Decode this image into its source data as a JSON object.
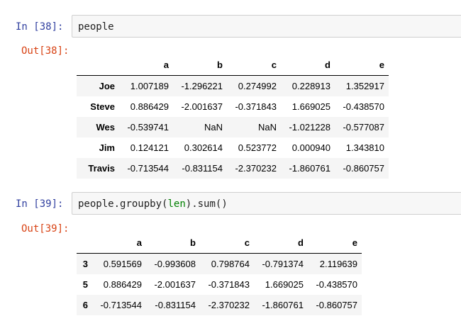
{
  "cells": [
    {
      "in_prompt": "In  [38]:",
      "code": "people",
      "out_prompt": "Out[38]:",
      "table": {
        "columns": [
          "a",
          "b",
          "c",
          "d",
          "e"
        ],
        "rows": [
          {
            "index": "Joe",
            "values": [
              "1.007189",
              "-1.296221",
              "0.274992",
              "0.228913",
              "1.352917"
            ]
          },
          {
            "index": "Steve",
            "values": [
              "0.886429",
              "-2.001637",
              "-0.371843",
              "1.669025",
              "-0.438570"
            ]
          },
          {
            "index": "Wes",
            "values": [
              "-0.539741",
              "NaN",
              "NaN",
              "-1.021228",
              "-0.577087"
            ]
          },
          {
            "index": "Jim",
            "values": [
              "0.124121",
              "0.302614",
              "0.523772",
              "0.000940",
              "1.343810"
            ]
          },
          {
            "index": "Travis",
            "values": [
              "-0.713544",
              "-0.831154",
              "-2.370232",
              "-1.860761",
              "-0.860757"
            ]
          }
        ]
      }
    },
    {
      "in_prompt": "In  [39]:",
      "code_parts": [
        "people.",
        "groupby",
        "(",
        "len",
        ").",
        "sum",
        "()"
      ],
      "out_prompt": "Out[39]:",
      "table": {
        "columns": [
          "a",
          "b",
          "c",
          "d",
          "e"
        ],
        "rows": [
          {
            "index": "3",
            "values": [
              "0.591569",
              "-0.993608",
              "0.798764",
              "-0.791374",
              "2.119639"
            ]
          },
          {
            "index": "5",
            "values": [
              "0.886429",
              "-2.001637",
              "-0.371843",
              "1.669025",
              "-0.438570"
            ]
          },
          {
            "index": "6",
            "values": [
              "-0.713544",
              "-0.831154",
              "-2.370232",
              "-1.860761",
              "-0.860757"
            ]
          }
        ]
      }
    }
  ]
}
